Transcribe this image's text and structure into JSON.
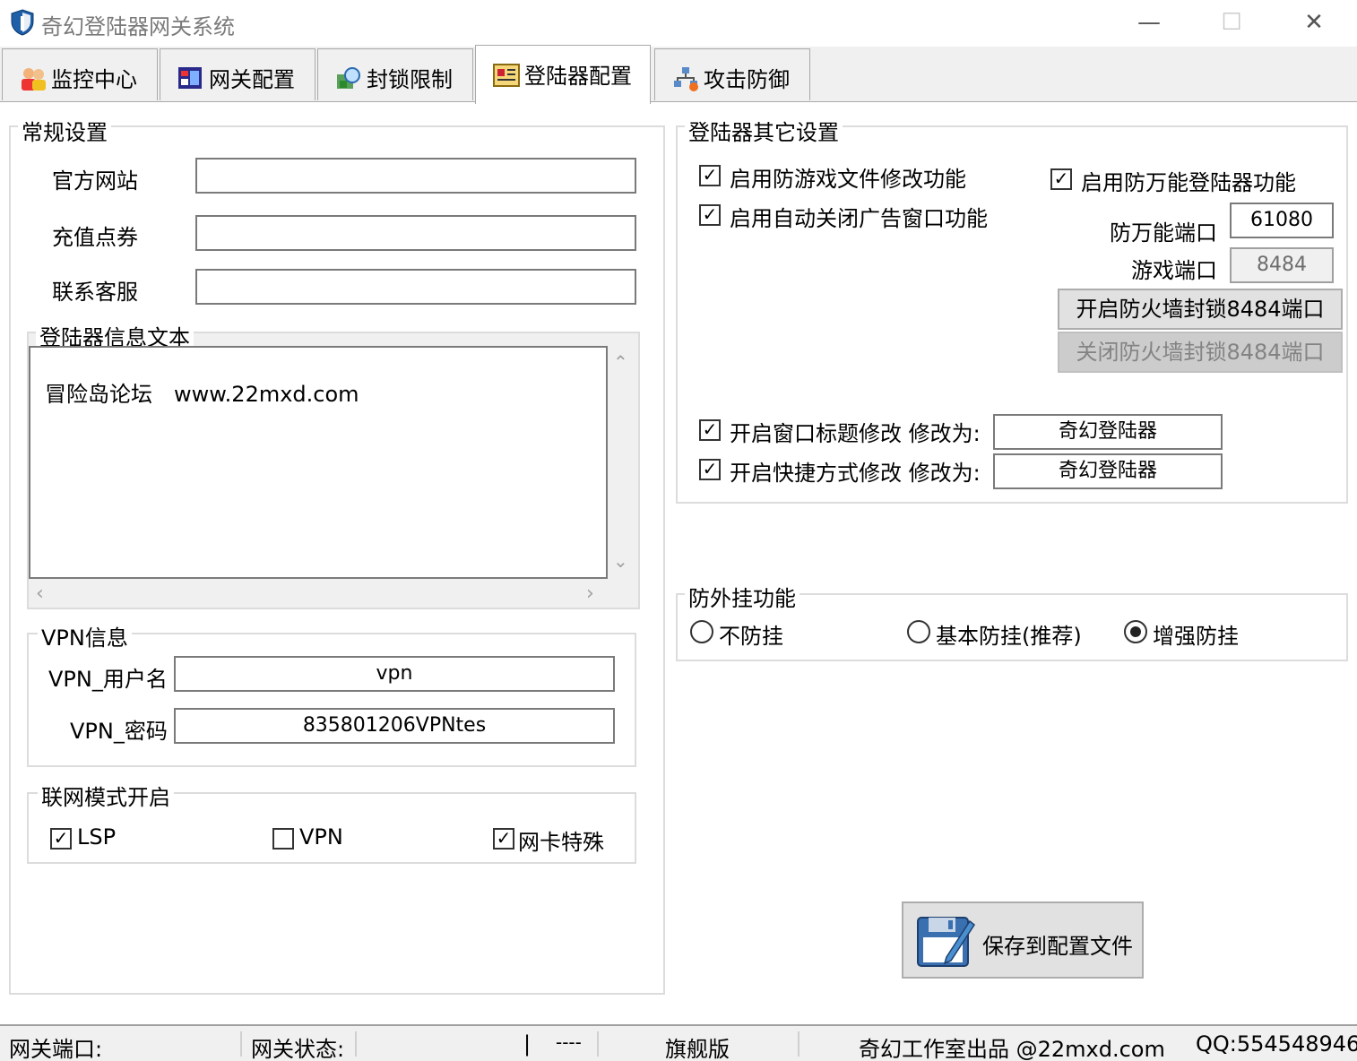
{
  "window": {
    "title": "奇幻登陆器网关系统",
    "minimize": "—",
    "maximize": "☐",
    "close": "✕"
  },
  "tabs": [
    {
      "label": "监控中心",
      "icon": "people-icon"
    },
    {
      "label": "网关配置",
      "icon": "gateway-icon"
    },
    {
      "label": "封锁限制",
      "icon": "search-lock-icon"
    },
    {
      "label": "登陆器配置",
      "icon": "launcher-config-icon",
      "active": true
    },
    {
      "label": "攻击防御",
      "icon": "network-defense-icon"
    }
  ],
  "general": {
    "title": "常规设置",
    "official_site_label": "官方网站",
    "official_site_value": "",
    "recharge_label": "充值点券",
    "recharge_value": "",
    "support_label": "联系客服",
    "support_value": ""
  },
  "launcher_text": {
    "title": "登陆器信息文本",
    "line1": "冒险岛论坛　www.22mxd.com"
  },
  "vpn": {
    "title": "VPN信息",
    "user_label": "VPN_用户名",
    "user_value": "vpn",
    "pass_label": "VPN_密码",
    "pass_value": "835801206VPNtes"
  },
  "network_mode": {
    "title": "联网模式开启",
    "lsp": {
      "label": "LSP",
      "checked": true
    },
    "vpn": {
      "label": "VPN",
      "checked": false
    },
    "nic": {
      "label": "网卡特殊",
      "checked": true
    }
  },
  "other": {
    "title": "登陆器其它设置",
    "anti_modify": {
      "label": "启用防游戏文件修改功能",
      "checked": true
    },
    "auto_close_ads": {
      "label": "启用自动关闭广告窗口功能",
      "checked": true
    },
    "anti_universal": {
      "label": "启用防万能登陆器功能",
      "checked": true
    },
    "anti_port_label": "防万能端口",
    "anti_port_value": "61080",
    "game_port_label": "游戏端口",
    "game_port_value": "8484",
    "open_fw_button": "开启防火墙封锁8484端口",
    "close_fw_button": "关闭防火墙封锁8484端口",
    "title_mod": {
      "label": "开启窗口标题修改 修改为:",
      "checked": true,
      "value": "奇幻登陆器"
    },
    "shortcut_mod": {
      "label": "开启快捷方式修改 修改为:",
      "checked": true,
      "value": "奇幻登陆器"
    }
  },
  "anticheat": {
    "title": "防外挂功能",
    "options": [
      {
        "label": "不防挂",
        "selected": false
      },
      {
        "label": "基本防挂(推荐)",
        "selected": false
      },
      {
        "label": "增强防挂",
        "selected": true
      }
    ]
  },
  "save_button": "保存到配置文件",
  "statusbar": {
    "port_label": "网关端口:",
    "state_label": "网关状态:",
    "pipe": "|",
    "dashes": "----",
    "edition": "旗舰版",
    "credit": "奇幻工作室出品 @22mxd.com",
    "qq": "QQ:554548946"
  },
  "colors": {
    "accent_blue": "#1e5fa8",
    "panel_bg": "#ffffff",
    "window_bg": "#f0f0f0"
  }
}
